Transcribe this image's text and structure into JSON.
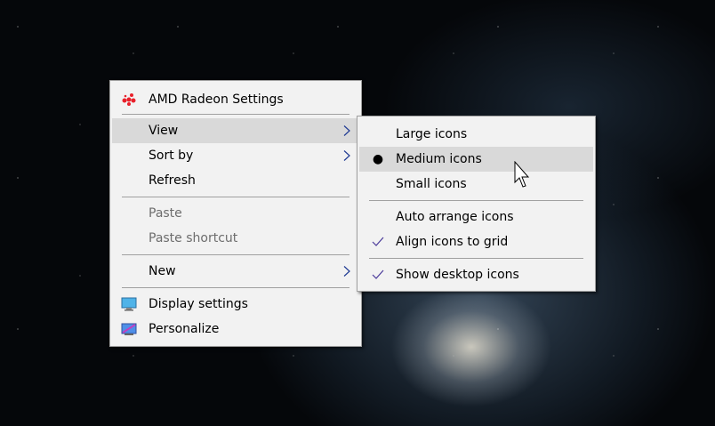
{
  "main_menu": {
    "items": [
      {
        "label": "AMD Radeon Settings",
        "icon": "amd-radeon-icon"
      },
      {
        "label": "View",
        "submenu": true,
        "highlighted": true
      },
      {
        "label": "Sort by",
        "submenu": true
      },
      {
        "label": "Refresh"
      },
      {
        "label": "Paste",
        "disabled": true
      },
      {
        "label": "Paste shortcut",
        "disabled": true
      },
      {
        "label": "New",
        "submenu": true
      },
      {
        "label": "Display settings",
        "icon": "display-icon"
      },
      {
        "label": "Personalize",
        "icon": "personalize-icon"
      }
    ]
  },
  "view_submenu": {
    "items": [
      {
        "label": "Large icons"
      },
      {
        "label": "Medium icons",
        "selected": true,
        "mark": "bullet",
        "highlighted": true
      },
      {
        "label": "Small icons"
      },
      {
        "label": "Auto arrange icons"
      },
      {
        "label": "Align icons to grid",
        "checked": true
      },
      {
        "label": "Show desktop icons",
        "checked": true
      }
    ]
  },
  "colors": {
    "menu_bg": "#f2f2f2",
    "highlight": "#d9d9d9",
    "amd_red": "#e8202a",
    "arrow": "#1f3a93"
  }
}
